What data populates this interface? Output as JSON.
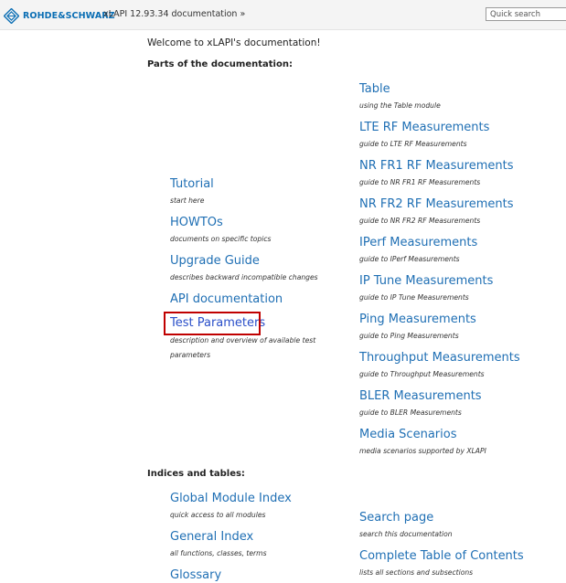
{
  "header": {
    "brand": "ROHDE&SCHWARZ",
    "breadcrumb": "xLAPI 12.93.34 documentation »",
    "search_placeholder": "Quick search",
    "brand_color": "#0a6eb4"
  },
  "main": {
    "welcome": "Welcome to xLAPI's documentation!",
    "parts_heading": "Parts of the documentation:",
    "left_links": [
      {
        "title": "Tutorial",
        "desc": "start here"
      },
      {
        "title": "HOWTOs",
        "desc": "documents on specific topics"
      },
      {
        "title": "Upgrade Guide",
        "desc": "describes backward incompatible changes"
      },
      {
        "title": "API documentation",
        "desc": ""
      },
      {
        "title": "Test Parameters",
        "desc": "description and overview of available test parameters"
      }
    ],
    "right_links": [
      {
        "title": "Table",
        "desc": "using the Table module"
      },
      {
        "title": "LTE RF Measurements",
        "desc": "guide to LTE RF Measurements"
      },
      {
        "title": "NR FR1 RF Measurements",
        "desc": "guide to NR FR1 RF Measurements"
      },
      {
        "title": "NR FR2 RF Measurements",
        "desc": "guide to NR FR2 RF Measurements"
      },
      {
        "title": "IPerf Measurements",
        "desc": "guide to IPerf Measurements"
      },
      {
        "title": "IP Tune Measurements",
        "desc": "guide to IP Tune Measurements"
      },
      {
        "title": "Ping Measurements",
        "desc": "guide to Ping Measurements"
      },
      {
        "title": "Throughput Measurements",
        "desc": "guide to Throughput Measurements"
      },
      {
        "title": "BLER Measurements",
        "desc": "guide to BLER Measurements"
      },
      {
        "title": "Media Scenarios",
        "desc": "media scenarios supported by XLAPI"
      }
    ],
    "indices_heading": "Indices and tables:",
    "indices_left": [
      {
        "title": "Global Module Index",
        "desc": "quick access to all modules"
      },
      {
        "title": "General Index",
        "desc": "all functions, classes, terms"
      },
      {
        "title": "Glossary",
        "desc": ""
      }
    ],
    "indices_right": [
      {
        "title": "Search page",
        "desc": "search this documentation"
      },
      {
        "title": "Complete Table of Contents",
        "desc": "lists all sections and subsections"
      }
    ],
    "link_color": "#1f6fb4",
    "highlight_color": "#c00000"
  }
}
